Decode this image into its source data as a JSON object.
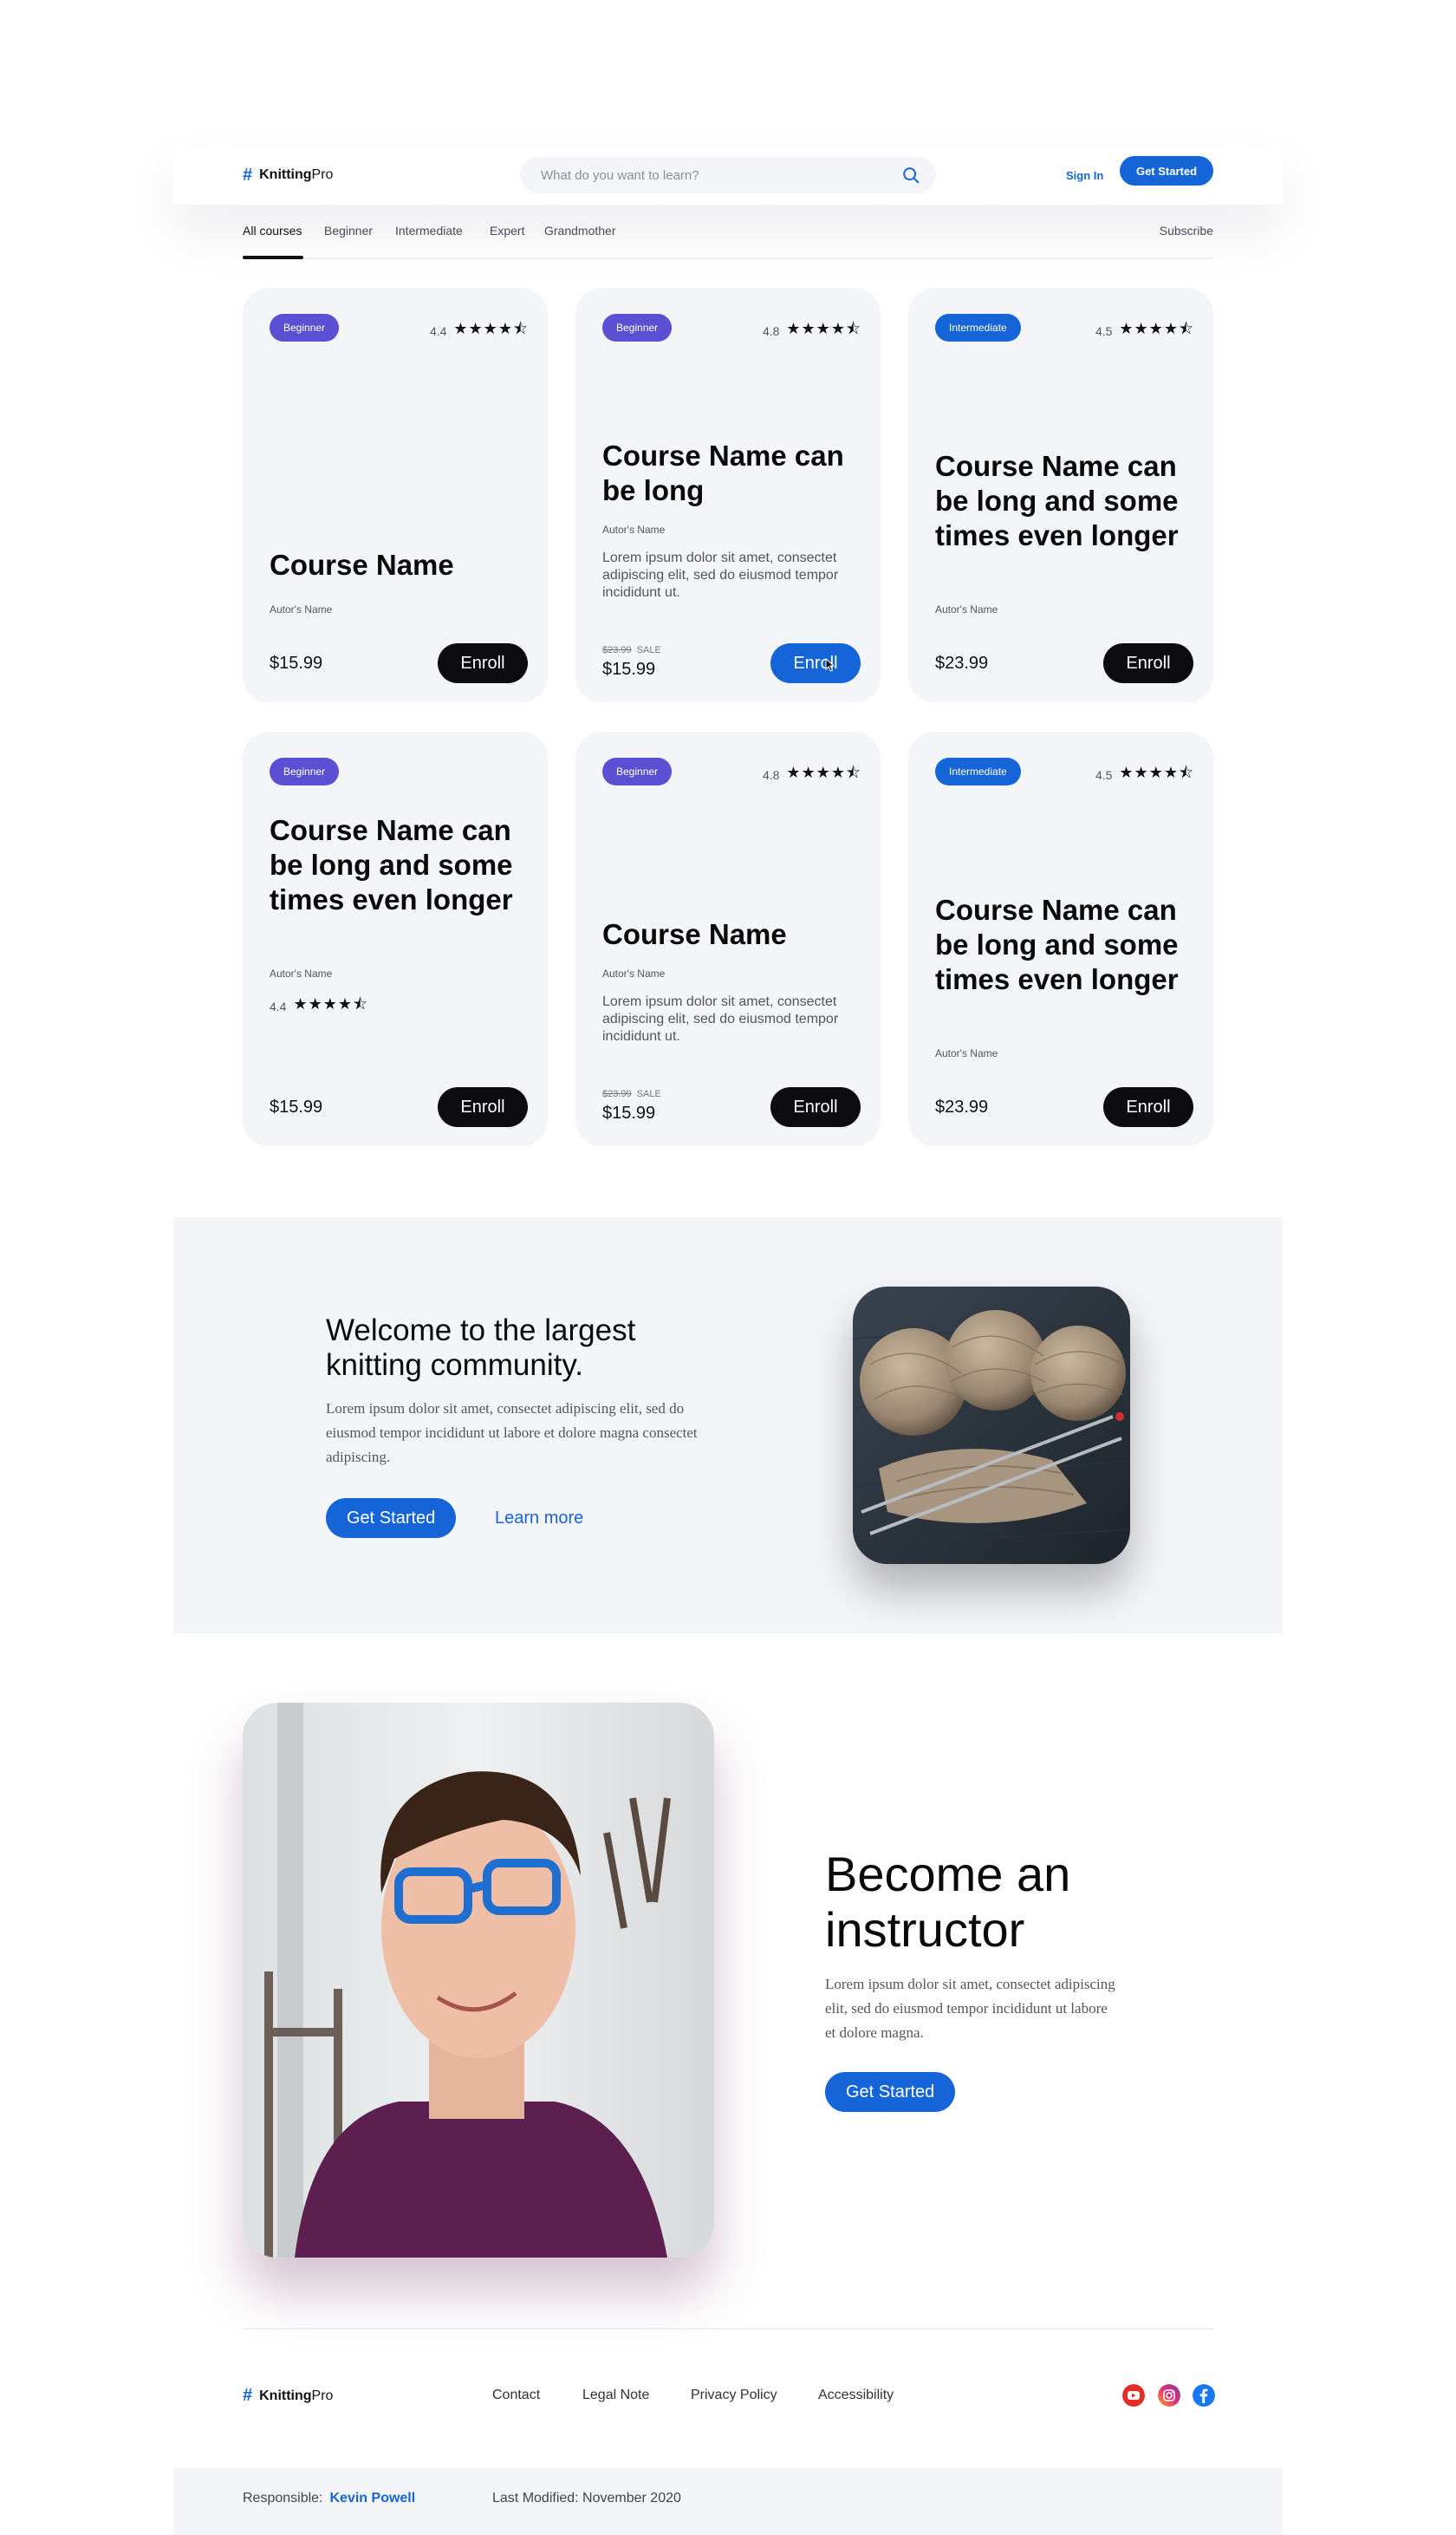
{
  "brand": {
    "name_bold": "Knitting",
    "name_light": "Pro"
  },
  "header": {
    "search_placeholder": "What do you want to learn?",
    "sign_in": "Sign In",
    "get_started": "Get Started"
  },
  "tabs": {
    "items": [
      "All courses",
      "Beginner",
      "Intermediate",
      "Expert",
      "Grandmother"
    ],
    "active": "All courses",
    "subscribe": "Subscribe"
  },
  "courses": [
    {
      "level": "Beginner",
      "rating": "4.4",
      "stars": 4.5,
      "title": "Course Name",
      "author": "Autor's Name",
      "price": "$15.99",
      "enroll": "Enroll"
    },
    {
      "level": "Beginner",
      "rating": "4.8",
      "stars": 4.5,
      "title": "Course Name can be long",
      "author": "Autor's Name",
      "desc": "Lorem ipsum dolor sit amet, consectet  adipiscing elit, sed do eiusmod tempor incididunt ut.",
      "old_price": "$23.99",
      "sale": "SALE",
      "price": "$15.99",
      "enroll": "Enroll"
    },
    {
      "level": "Intermediate",
      "rating": "4.5",
      "stars": 4.5,
      "title": "Course Name can be long and some times even longer",
      "author": "Autor's Name",
      "price": "$23.99",
      "enroll": "Enroll"
    },
    {
      "level": "Beginner",
      "rating": "4.4",
      "stars": 4.5,
      "title": "Course Name can be long and some times even longer",
      "author": "Autor's Name",
      "price": "$15.99",
      "enroll": "Enroll"
    },
    {
      "level": "Beginner",
      "rating": "4.8",
      "stars": 4.5,
      "title": "Course Name",
      "author": "Autor's Name",
      "desc": "Lorem ipsum dolor sit amet, consectet  adipiscing elit, sed do eiusmod tempor incididunt ut.",
      "old_price": "$23.99",
      "sale": "SALE",
      "price": "$15.99",
      "enroll": "Enroll"
    },
    {
      "level": "Intermediate",
      "rating": "4.5",
      "stars": 4.5,
      "title": "Course Name can be long and some times even longer",
      "author": "Autor's Name",
      "price": "$23.99",
      "enroll": "Enroll"
    }
  ],
  "stars_glyph": "★★★★⯪",
  "community": {
    "heading": "Welcome to the largest knitting community.",
    "body": "Lorem ipsum dolor sit amet, consectet  adipiscing elit, sed do eiusmod tempor incididunt ut labore et dolore magna consectet  adipiscing.",
    "get_started": "Get Started",
    "learn_more": "Learn more"
  },
  "instructor": {
    "heading": "Become an instructor",
    "body": "Lorem ipsum dolor sit amet, consectet adipiscing elit, sed do eiusmod tempor incididunt ut labore et dolore magna.",
    "get_started": "Get Started"
  },
  "footer": {
    "links": [
      "Contact",
      "Legal Note",
      "Privacy Policy",
      "Accessibility"
    ],
    "social": [
      "youtube-icon",
      "instagram-icon",
      "facebook-icon"
    ],
    "responsible_label": "Responsible:",
    "responsible_name": "Kevin Powell",
    "last_modified": "Last Modified:  November 2020"
  },
  "colors": {
    "accent": "#1565d8",
    "beginner_badge": "#5b4fd3",
    "card_bg": "#f4f5f9",
    "dark_button": "#0c0c0f"
  }
}
